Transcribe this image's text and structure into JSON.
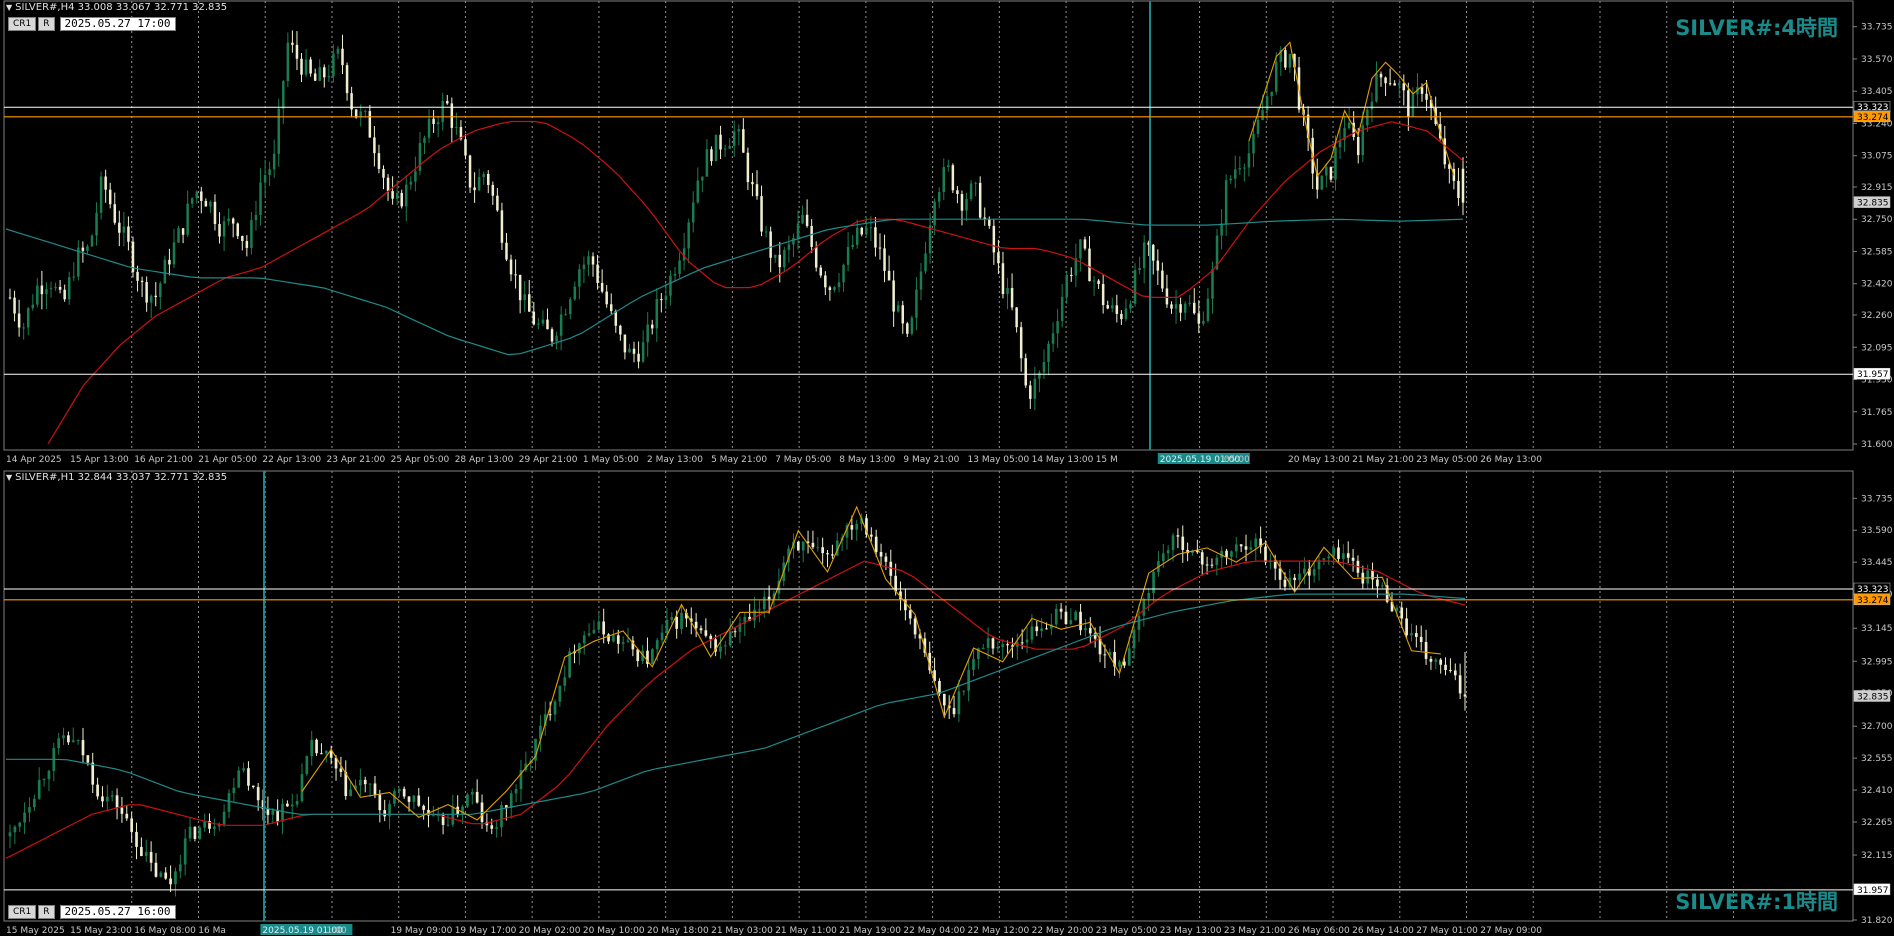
{
  "panes": [
    {
      "id": "top",
      "header": "SILVER#,H4  33.008 33.067 32.771 32.835",
      "buttons": [
        "CR1",
        "R"
      ],
      "datetime": "2025.05.27 17:00",
      "title": "SILVER#:4時間",
      "price_labels": [
        "33.735",
        "33.570",
        "33.405",
        "33.240",
        "33.075",
        "32.915",
        "32.750",
        "32.585",
        "32.420",
        "32.260",
        "32.095",
        "31.930",
        "31.765",
        "31.600"
      ],
      "time_labels": [
        "14 Apr 2025",
        "15 Apr 13:00",
        "16 Apr 21:00",
        "21 Apr 05:00",
        "22 Apr 13:00",
        "23 Apr 21:00",
        "25 Apr 05:00",
        "28 Apr 13:00",
        "29 Apr 21:00",
        "1 May 05:00",
        "2 May 13:00",
        "5 May 21:00",
        "7 May 05:00",
        "8 May 13:00",
        "9 May 21:00",
        "13 May 05:00",
        "14 May 13:00",
        "15 M",
        "2025.05.19 01:00",
        "05:00",
        "20 May 13:00",
        "21 May 21:00",
        "23 May 05:00",
        "26 May 13:00"
      ],
      "tags": [
        {
          "text": "33.323",
          "bg": "#000000",
          "fg": "#ffffff",
          "value": 33.323
        },
        {
          "text": "33.274",
          "bg": "#ff9900",
          "fg": "#000000",
          "value": 33.274
        },
        {
          "text": "32.835",
          "bg": "#d0d0d0",
          "fg": "#000000",
          "value": 32.835
        },
        {
          "text": "31.957",
          "bg": "#ffffff",
          "fg": "#000000",
          "value": 31.957
        }
      ]
    },
    {
      "id": "bottom",
      "header": "SILVER#,H1  32.844 33.037 32.771 32.835",
      "buttons": [
        "CR1",
        "R"
      ],
      "datetime": "2025.05.27 16:00",
      "title": "SILVER#:1時間",
      "price_labels": [
        "33.735",
        "33.590",
        "33.445",
        "33.300",
        "33.145",
        "32.995",
        "32.850",
        "32.700",
        "32.555",
        "32.410",
        "32.265",
        "32.115",
        "31.820"
      ],
      "time_labels": [
        "15 May 2025",
        "15 May 23:00",
        "16 May 08:00",
        "16 Ma",
        "2025.05.19 01:00",
        "1:00",
        "19 May 09:00",
        "19 May 17:00",
        "20 May 02:00",
        "20 May 10:00",
        "20 May 18:00",
        "21 May 03:00",
        "21 May 11:00",
        "21 May 19:00",
        "22 May 04:00",
        "22 May 12:00",
        "22 May 20:00",
        "23 May 05:00",
        "23 May 13:00",
        "23 May 21:00",
        "26 May 06:00",
        "26 May 14:00",
        "27 May 01:00",
        "27 May 09:00"
      ],
      "tags": [
        {
          "text": "33.323",
          "bg": "#000000",
          "fg": "#ffffff",
          "value": 33.323
        },
        {
          "text": "33.274",
          "bg": "#ff9900",
          "fg": "#000000",
          "value": 33.274
        },
        {
          "text": "32.835",
          "bg": "#d0d0d0",
          "fg": "#000000",
          "value": 32.835
        },
        {
          "text": "31.957",
          "bg": "#ffffff",
          "fg": "#000000",
          "value": 31.957
        }
      ]
    }
  ],
  "colors": {
    "background": "#000000",
    "bull": "#1a7d52",
    "bear": "#f0f0d0",
    "ma_fast": "#cc1111",
    "ma_slow": "#1e8a8a",
    "zigzag": "#e0a000",
    "hline_orange": "#ff9900",
    "hline_white": "#ffffff",
    "vline_teal": "#1b8a8a",
    "grid": "#808080",
    "active_bar": "#22aa22"
  },
  "chart_data": [
    {
      "type": "candlestick",
      "symbol": "SILVER#",
      "timeframe": "H4",
      "ohlc": [
        33.008,
        33.067,
        32.771,
        32.835
      ],
      "ylim": [
        31.6,
        33.8
      ],
      "hlines": [
        33.323,
        33.274,
        31.957
      ],
      "path": [
        32.35,
        32.2,
        32.4,
        32.45,
        32.3,
        32.55,
        32.6,
        32.95,
        32.75,
        32.6,
        32.4,
        32.35,
        32.55,
        32.7,
        32.9,
        32.85,
        32.7,
        32.75,
        32.6,
        32.95,
        33.05,
        33.65,
        33.55,
        33.45,
        33.5,
        33.6,
        33.3,
        33.25,
        33.05,
        32.8,
        32.9,
        33.1,
        33.25,
        33.35,
        33.15,
        32.9,
        33.0,
        32.75,
        32.5,
        32.3,
        32.2,
        32.15,
        32.3,
        32.5,
        32.55,
        32.35,
        32.15,
        32.05,
        32.1,
        32.3,
        32.45,
        32.65,
        32.95,
        33.1,
        33.15,
        33.2,
        32.95,
        32.7,
        32.5,
        32.6,
        32.75,
        32.55,
        32.4,
        32.5,
        32.65,
        32.7,
        32.55,
        32.3,
        32.1,
        32.5,
        32.9,
        33.0,
        32.85,
        32.9,
        32.7,
        32.45,
        32.25,
        31.85,
        31.95,
        32.2,
        32.45,
        32.6,
        32.45,
        32.3,
        32.25,
        32.4,
        32.6,
        32.45,
        32.3,
        32.35,
        32.2,
        32.45,
        32.9,
        33.05,
        33.1,
        33.35,
        33.55,
        33.6,
        33.2,
        32.9,
        33.0,
        33.25,
        33.1,
        33.4,
        33.5,
        33.45,
        33.3,
        33.45,
        33.2,
        32.95,
        32.835
      ],
      "ma_fast": [
        31.6,
        31.9,
        32.1,
        32.25,
        32.35,
        32.45,
        32.5,
        32.6,
        32.7,
        32.8,
        32.95,
        33.1,
        33.2,
        33.25,
        33.25,
        33.15,
        33.0,
        32.8,
        32.55,
        32.4,
        32.4,
        32.5,
        32.65,
        32.75,
        32.75,
        32.7,
        32.65,
        32.6,
        32.6,
        32.55,
        32.45,
        32.35,
        32.35,
        32.5,
        32.75,
        32.95,
        33.1,
        33.2,
        33.25,
        33.2,
        33.05
      ],
      "ma_slow": [
        32.7,
        32.6,
        32.5,
        32.45,
        32.45,
        32.4,
        32.3,
        32.15,
        32.05,
        32.15,
        32.35,
        32.5,
        32.6,
        32.7,
        32.75,
        32.75,
        32.75,
        32.75,
        32.72,
        32.72,
        32.74,
        32.75,
        32.74,
        32.75
      ]
    },
    {
      "type": "candlestick",
      "symbol": "SILVER#",
      "timeframe": "H1",
      "ohlc": [
        32.844,
        33.037,
        32.771,
        32.835
      ],
      "ylim": [
        31.82,
        33.8
      ],
      "hlines": [
        33.323,
        33.274,
        31.957
      ],
      "path": [
        32.2,
        32.35,
        32.5,
        32.65,
        32.6,
        32.4,
        32.35,
        32.2,
        32.05,
        31.98,
        32.2,
        32.25,
        32.3,
        32.55,
        32.35,
        32.3,
        32.35,
        32.6,
        32.55,
        32.4,
        32.45,
        32.3,
        32.4,
        32.35,
        32.25,
        32.3,
        32.4,
        32.2,
        32.35,
        32.5,
        32.7,
        32.9,
        33.1,
        33.15,
        33.1,
        33.05,
        33.0,
        33.15,
        33.2,
        33.1,
        33.05,
        33.15,
        33.2,
        33.3,
        33.55,
        33.5,
        33.45,
        33.6,
        33.65,
        33.5,
        33.3,
        33.15,
        32.9,
        32.75,
        32.95,
        33.1,
        33.05,
        33.1,
        33.15,
        33.2,
        33.2,
        33.1,
        33.0,
        33.0,
        33.3,
        33.5,
        33.55,
        33.45,
        33.45,
        33.5,
        33.55,
        33.45,
        33.35,
        33.4,
        33.45,
        33.5,
        33.4,
        33.35,
        33.25,
        33.1,
        33.0,
        32.95,
        32.835
      ],
      "ma_fast": [
        32.1,
        32.2,
        32.3,
        32.35,
        32.3,
        32.25,
        32.25,
        32.3,
        32.3,
        32.3,
        32.3,
        32.25,
        32.3,
        32.45,
        32.7,
        32.9,
        33.05,
        33.15,
        33.25,
        33.35,
        33.45,
        33.4,
        33.25,
        33.1,
        33.05,
        33.05,
        33.15,
        33.3,
        33.4,
        33.45,
        33.45,
        33.45,
        33.4,
        33.3,
        33.25
      ],
      "ma_slow": [
        32.55,
        32.55,
        32.5,
        32.4,
        32.35,
        32.3,
        32.3,
        32.3,
        32.3,
        32.35,
        32.4,
        32.5,
        32.55,
        32.6,
        32.7,
        32.8,
        32.85,
        32.95,
        33.05,
        33.15,
        33.22,
        33.27,
        33.3,
        33.3,
        33.3,
        33.28
      ]
    }
  ]
}
